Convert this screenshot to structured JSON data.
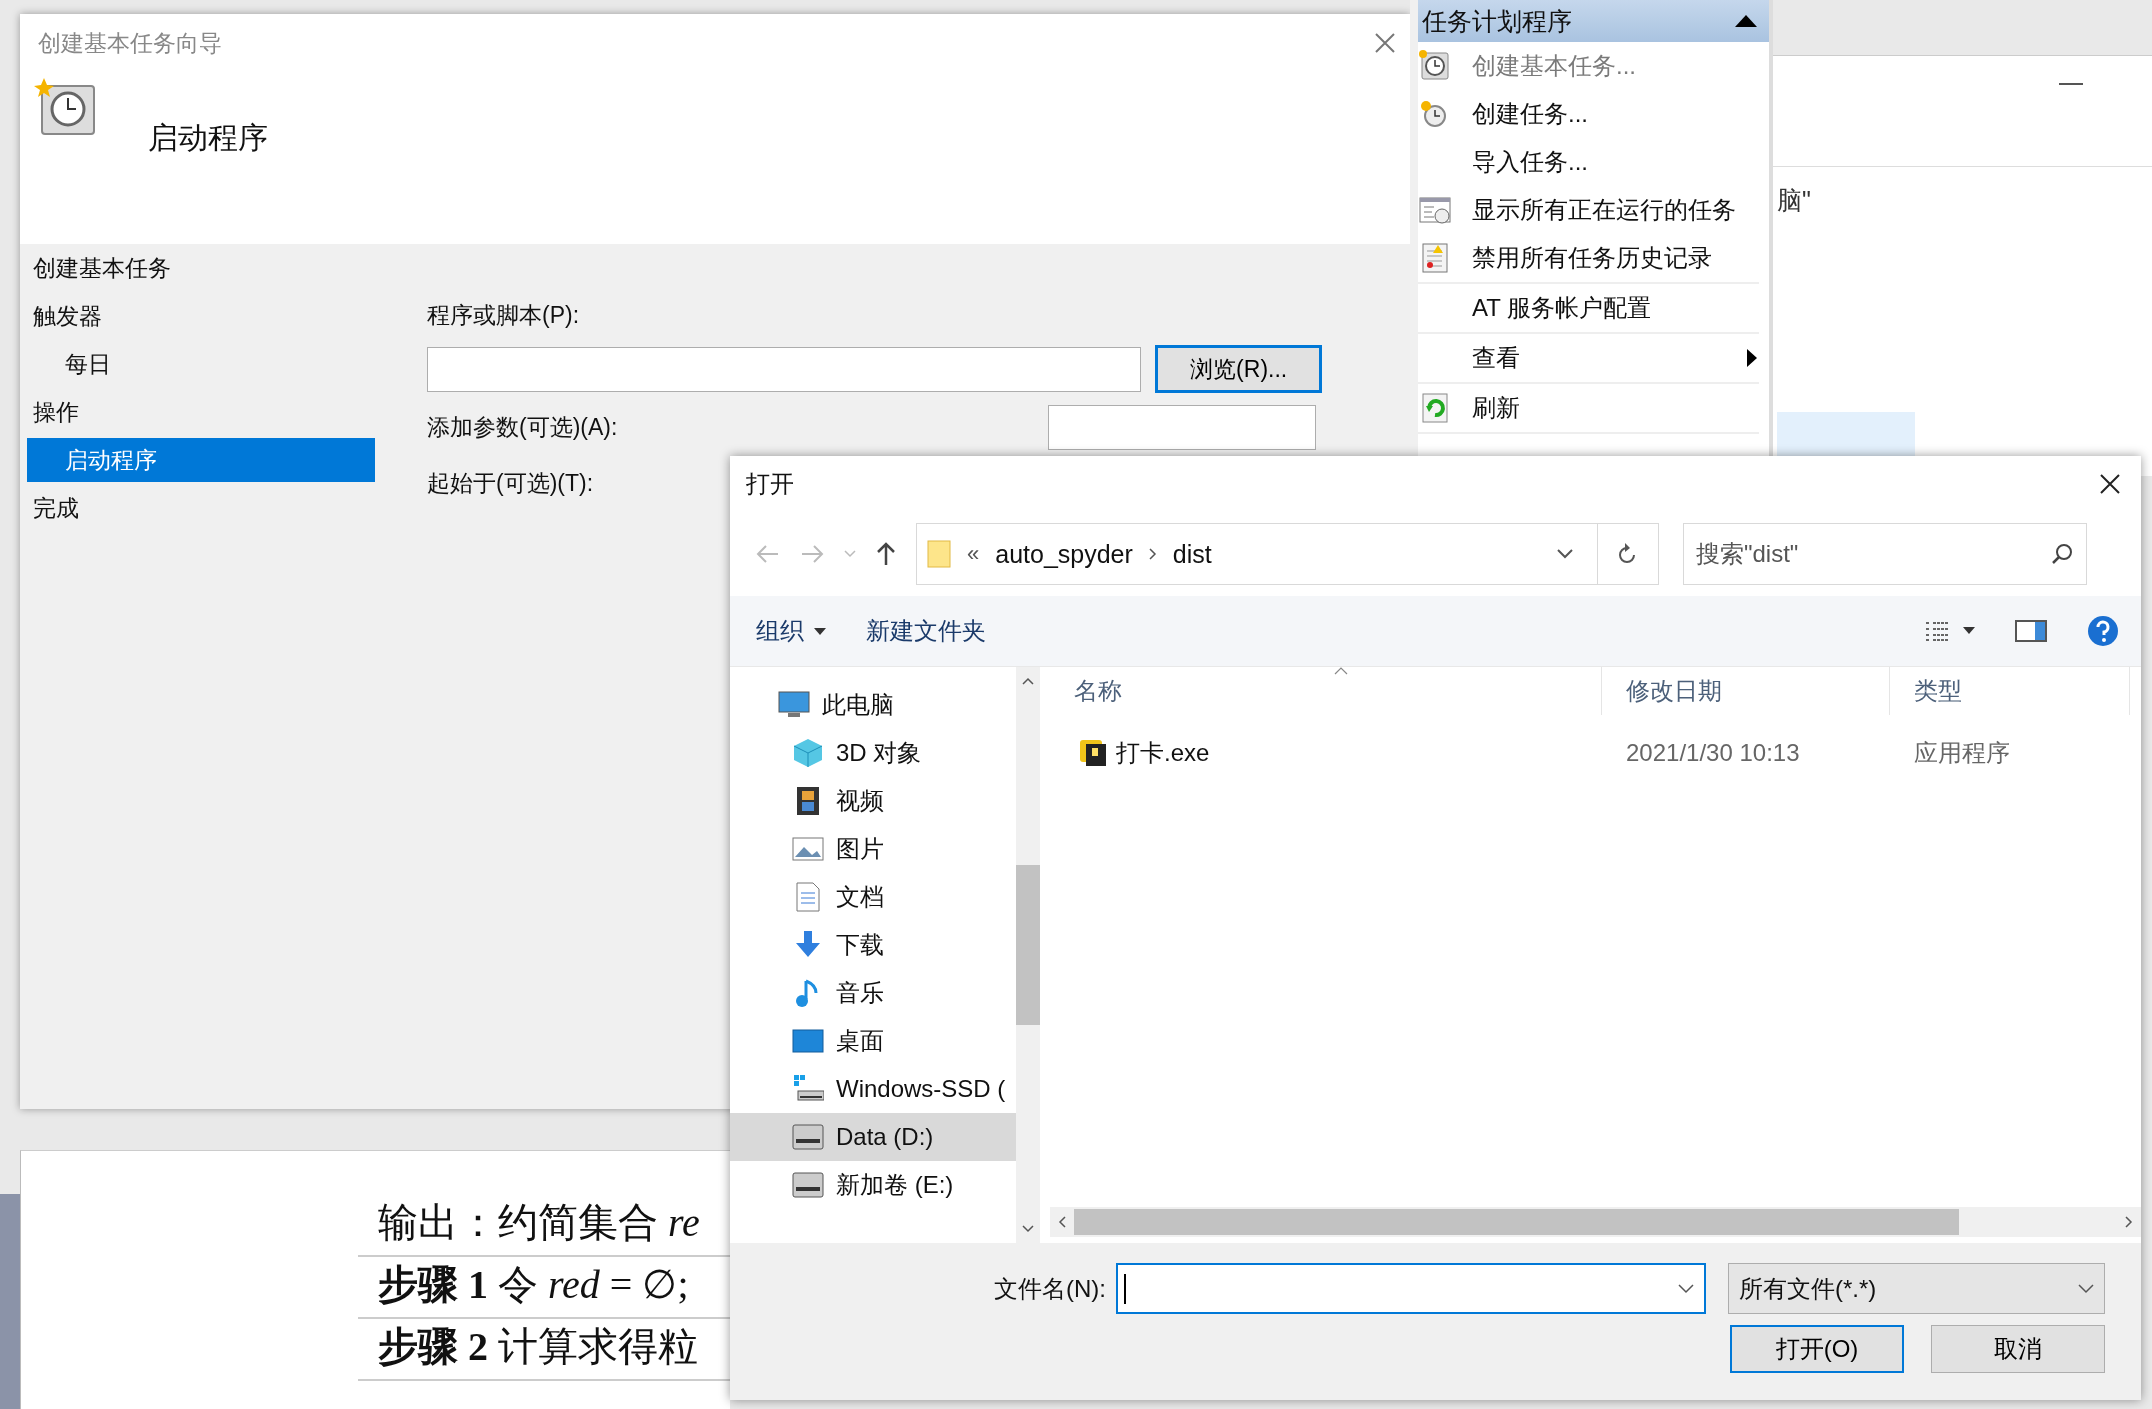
{
  "background_window": {
    "fragment": "脑\""
  },
  "document": {
    "lines": [
      "输出：约简集合 *re*",
      "**步骤 1** 令 *red* = ∅;",
      "**步骤 2** 计算求得粒"
    ]
  },
  "wizard": {
    "title": "创建基本任务向导",
    "header_title": "启动程序",
    "nav": [
      {
        "label": "创建基本任务",
        "selected": false
      },
      {
        "label": "触发器",
        "selected": false,
        "children": [
          {
            "label": "每日",
            "selected": false
          }
        ]
      },
      {
        "label": "操作",
        "selected": false,
        "children": [
          {
            "label": "启动程序",
            "selected": true
          }
        ]
      },
      {
        "label": "完成",
        "selected": false
      }
    ],
    "fields": [
      {
        "kind": "wide",
        "label": "程序或脚本(P):",
        "button": {
          "label": "浏览(R)...",
          "focused": true
        }
      },
      {
        "kind": "short",
        "label": "添加参数(可选)(A):"
      },
      {
        "kind": "label",
        "label": "起始于(可选)(T):"
      }
    ]
  },
  "actions_panel": {
    "header": "任务计划程序",
    "items": [
      {
        "label": "创建基本任务...",
        "disabled": true,
        "submenu": false
      },
      {
        "label": "创建任务...",
        "disabled": false,
        "submenu": false
      },
      {
        "label": "导入任务...",
        "disabled": false,
        "submenu": false
      },
      {
        "label": "显示所有正在运行的任务",
        "disabled": false,
        "submenu": false
      },
      {
        "label": "禁用所有任务历史记录",
        "disabled": false,
        "submenu": false
      },
      {
        "label": "AT 服务帐户配置",
        "disabled": false,
        "submenu": false
      },
      {
        "label": "查看",
        "disabled": false,
        "submenu": true
      },
      {
        "label": "刷新",
        "disabled": false,
        "submenu": false
      }
    ]
  },
  "open_dialog": {
    "title": "打开",
    "address": {
      "overflow": "«",
      "path": [
        "auto_spyder",
        "dist"
      ]
    },
    "search": {
      "placeholder": "搜索\"dist\""
    },
    "toolbar": {
      "organize": "组织",
      "new_folder": "新建文件夹"
    },
    "tree": [
      {
        "label": "此电脑",
        "selected": false,
        "children": [
          {
            "label": "3D 对象",
            "selected": false
          },
          {
            "label": "视频",
            "selected": false
          },
          {
            "label": "图片",
            "selected": false
          },
          {
            "label": "文档",
            "selected": false
          },
          {
            "label": "下载",
            "selected": false
          },
          {
            "label": "音乐",
            "selected": false
          },
          {
            "label": "桌面",
            "selected": false
          },
          {
            "label": "Windows-SSD (",
            "selected": false
          },
          {
            "label": "Data (D:)",
            "selected": true
          },
          {
            "label": "新加卷 (E:)",
            "selected": false
          }
        ]
      }
    ],
    "columns": [
      "名称",
      "修改日期",
      "类型"
    ],
    "rows": [
      {
        "cells": [
          "打卡.exe",
          "2021/1/30 10:13",
          "应用程序"
        ]
      }
    ],
    "filename": {
      "label": "文件名(N):",
      "focused": true
    },
    "filter": "所有文件(*.*)",
    "buttons": [
      {
        "label": "打开(O)",
        "default": true
      },
      {
        "label": "取消",
        "default": false
      }
    ]
  }
}
